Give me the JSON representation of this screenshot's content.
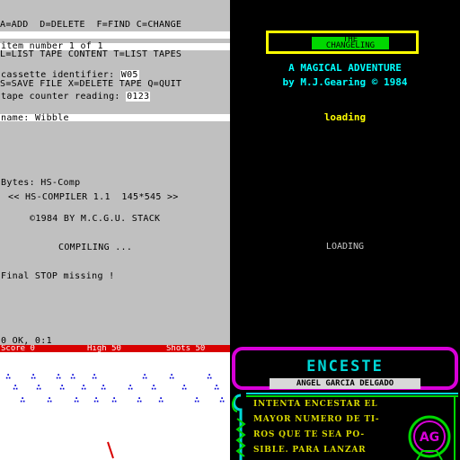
{
  "tape_manager": {
    "menu": [
      "A=ADD  D=DELETE  F=FIND C=CHANGE",
      "L=LIST TAPE CONTENT T=LIST TAPES",
      "S=SAVE FILE X=DELETE TAPE Q=QUIT"
    ],
    "item_label": "item number 1 of 1",
    "cassette_label": "cassette identifier:",
    "cassette_value": "W05",
    "counter_label": "tape counter reading:",
    "counter_value": "0123",
    "name_label": "name:",
    "name_value": "Wibble",
    "bytes_line": "Bytes: HS-Comp",
    "compiler_line": "<< HS-COMPILER 1.1  145*545 >>",
    "copyright_line": "©1984 BY M.C.G.U. STACK",
    "compiling_line": "COMPILING ...",
    "error_line": "Final STOP missing !",
    "status_line": "0 OK, 0:1"
  },
  "loader": {
    "title_line1": "THE",
    "title_line2": "CHANGELING",
    "subtitle": "A MAGICAL ADVENTURE",
    "author": "by M.J.Gearing © 1984",
    "loading_yellow": "loading",
    "loading_white": "LOADING"
  },
  "game": {
    "score_label": "Score 0",
    "high_label": "High 50",
    "shots_label": "Shots 50",
    "invader_glyph": "∴"
  },
  "enceste": {
    "title": "ENCESTE",
    "author": "ANGEL GARCIA DELGADO",
    "description_lines": [
      "INTENTA ENCESTAR EL",
      "MAYOR NUMERO DE TI-",
      "ROS QUE TE SEA PO-",
      "SIBLE. PARA LANZAR"
    ],
    "badge_text": "AG"
  },
  "colors": {
    "tape_bg": "#c0c0c0",
    "loader_border": "#ffff00",
    "title_bg": "#00d800",
    "hud_red": "#d80000",
    "invader_blue": "#0000d8",
    "frame_magenta": "#d800d8",
    "frame_green": "#00d800",
    "title_cyan": "#00d8d8"
  }
}
